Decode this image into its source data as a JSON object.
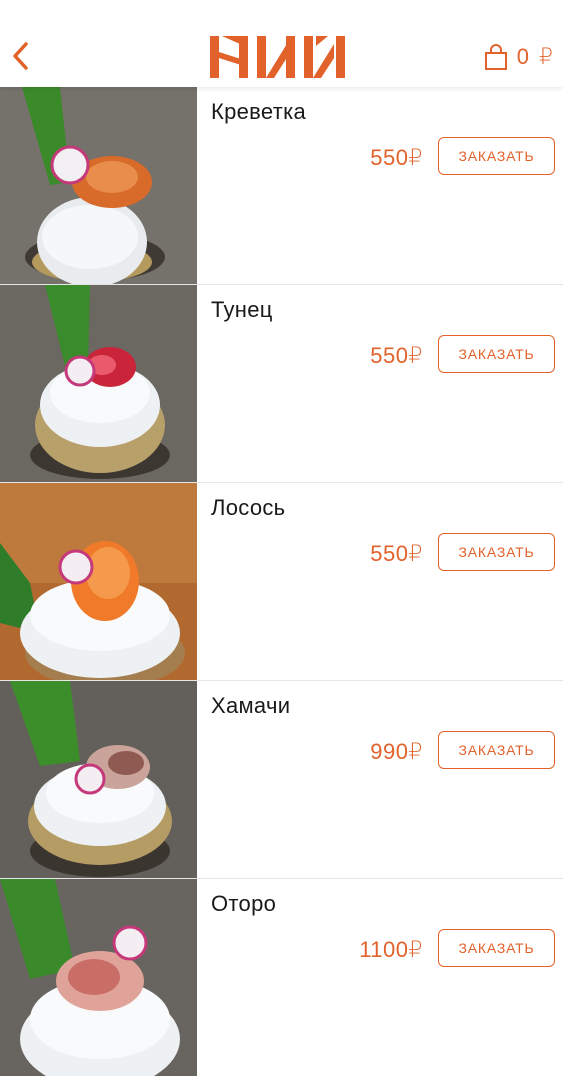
{
  "header": {
    "back_icon": "chevron-left-icon",
    "logo_text": "НИИ",
    "cart_icon": "shopping-bag-icon",
    "cart_count": "0",
    "currency": "₽"
  },
  "colors": {
    "accent": "#e2622b",
    "text": "#1a1a1a",
    "divider": "#e6e6e6"
  },
  "items": [
    {
      "name": "Креветка",
      "price": "550₽",
      "button": "ЗАКАЗАТЬ"
    },
    {
      "name": "Тунец",
      "price": "550₽",
      "button": "ЗАКАЗАТЬ"
    },
    {
      "name": "Лосось",
      "price": "550₽",
      "button": "ЗАКАЗАТЬ"
    },
    {
      "name": "Хамачи",
      "price": "990₽",
      "button": "ЗАКАЗАТЬ"
    },
    {
      "name": "Оторо",
      "price": "1100₽",
      "button": "ЗАКАЗАТЬ"
    }
  ]
}
